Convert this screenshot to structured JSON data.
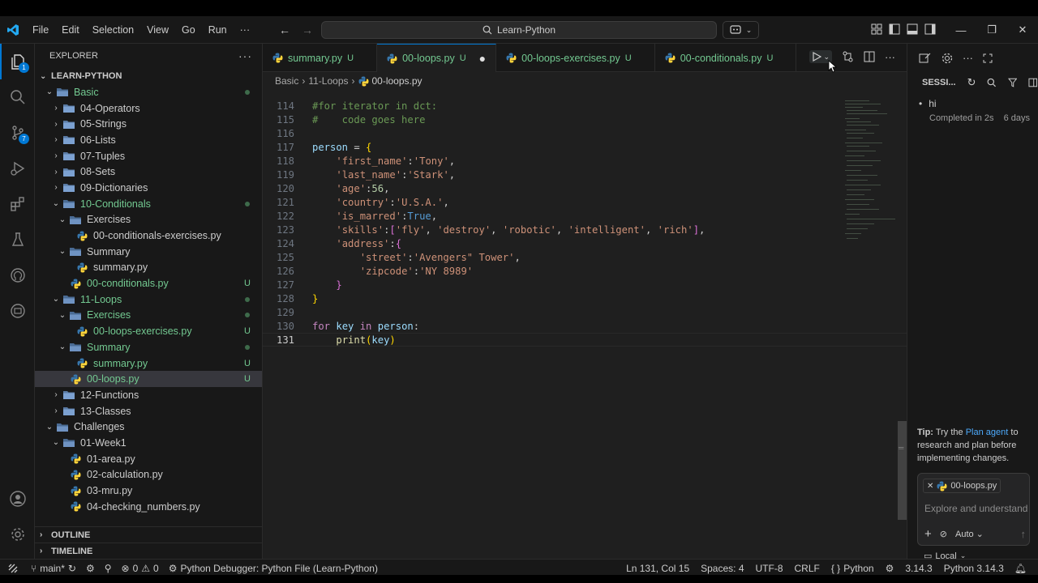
{
  "menu": [
    "File",
    "Edit",
    "Selection",
    "View",
    "Go",
    "Run",
    "···"
  ],
  "search": {
    "label": "Learn-Python"
  },
  "explorer": {
    "title": "EXPLORER",
    "root": "LEARN-PYTHON",
    "tree": [
      {
        "label": "Basic",
        "indent": 1,
        "type": "folder-open",
        "green": true,
        "dot": true
      },
      {
        "label": "04-Operators",
        "indent": 2,
        "type": "folder-closed"
      },
      {
        "label": "05-Strings",
        "indent": 2,
        "type": "folder-closed"
      },
      {
        "label": "06-Lists",
        "indent": 2,
        "type": "folder-closed"
      },
      {
        "label": "07-Tuples",
        "indent": 2,
        "type": "folder-closed"
      },
      {
        "label": "08-Sets",
        "indent": 2,
        "type": "folder-closed"
      },
      {
        "label": "09-Dictionaries",
        "indent": 2,
        "type": "folder-closed"
      },
      {
        "label": "10-Conditionals",
        "indent": 2,
        "type": "folder-open",
        "green": true,
        "dot": true
      },
      {
        "label": "Exercises",
        "indent": 3,
        "type": "folder-open"
      },
      {
        "label": "00-conditionals-exercises.py",
        "indent": 4,
        "type": "py"
      },
      {
        "label": "Summary",
        "indent": 3,
        "type": "folder-open"
      },
      {
        "label": "summary.py",
        "indent": 4,
        "type": "py"
      },
      {
        "label": "00-conditionals.py",
        "indent": 3,
        "type": "py",
        "green": true,
        "mark": "U"
      },
      {
        "label": "11-Loops",
        "indent": 2,
        "type": "folder-open",
        "green": true,
        "dot": true
      },
      {
        "label": "Exercises",
        "indent": 3,
        "type": "folder-open",
        "green": true,
        "dot": true
      },
      {
        "label": "00-loops-exercises.py",
        "indent": 4,
        "type": "py",
        "green": true,
        "mark": "U"
      },
      {
        "label": "Summary",
        "indent": 3,
        "type": "folder-open",
        "green": true,
        "dot": true
      },
      {
        "label": "summary.py",
        "indent": 4,
        "type": "py",
        "green": true,
        "mark": "U"
      },
      {
        "label": "00-loops.py",
        "indent": 3,
        "type": "py",
        "green": true,
        "mark": "U",
        "selected": true
      },
      {
        "label": "12-Functions",
        "indent": 2,
        "type": "folder-closed"
      },
      {
        "label": "13-Classes",
        "indent": 2,
        "type": "folder-closed"
      },
      {
        "label": "Challenges",
        "indent": 1,
        "type": "folder-open"
      },
      {
        "label": "01-Week1",
        "indent": 2,
        "type": "folder-open"
      },
      {
        "label": "01-area.py",
        "indent": 3,
        "type": "py"
      },
      {
        "label": "02-calculation.py",
        "indent": 3,
        "type": "py"
      },
      {
        "label": "03-mru.py",
        "indent": 3,
        "type": "py"
      },
      {
        "label": "04-checking_numbers.py",
        "indent": 3,
        "type": "py"
      }
    ],
    "outline": "OUTLINE",
    "timeline": "TIMELINE"
  },
  "tabs": [
    {
      "label": "summary.py",
      "mark": "U"
    },
    {
      "label": "00-loops.py",
      "mark": "U",
      "active": true,
      "dirty": true
    },
    {
      "label": "00-loops-exercises.py",
      "mark": "U"
    },
    {
      "label": "00-conditionals.py",
      "mark": "U"
    }
  ],
  "breadcrumb": [
    "Basic",
    "11-Loops",
    "00-loops.py"
  ],
  "code": [
    {
      "n": "114",
      "html": "<span class='c'>#for iterator in dct:</span>"
    },
    {
      "n": "115",
      "html": "<span class='c'>#    code goes here</span>"
    },
    {
      "n": "116",
      "html": ""
    },
    {
      "n": "117",
      "html": "<span class='v'>person</span> = <span class='y'>{</span>"
    },
    {
      "n": "118",
      "html": "    <span class='s'>'first_name'</span>:<span class='s'>'Tony'</span>,"
    },
    {
      "n": "119",
      "html": "    <span class='s'>'last_name'</span>:<span class='s'>'Stark'</span>,"
    },
    {
      "n": "120",
      "html": "    <span class='s'>'age'</span>:<span class='n'>56</span>,"
    },
    {
      "n": "121",
      "html": "    <span class='s'>'country'</span>:<span class='s'>'U.S.A.'</span>,"
    },
    {
      "n": "122",
      "html": "    <span class='s'>'is_marred'</span>:<span class='b'>True</span>,"
    },
    {
      "n": "123",
      "html": "    <span class='s'>'skills'</span>:<span class='p'>[</span><span class='s'>'fly'</span>, <span class='s'>'destroy'</span>, <span class='s'>'robotic'</span>, <span class='s'>'intelligent'</span>, <span class='s'>'rich'</span><span class='p'>]</span>,"
    },
    {
      "n": "124",
      "html": "    <span class='s'>'address'</span>:<span class='p'>{</span>"
    },
    {
      "n": "125",
      "html": "        <span class='s'>'street'</span>:<span class='s'>'Avengers\" Tower'</span>,"
    },
    {
      "n": "126",
      "html": "        <span class='s'>'zipcode'</span>:<span class='s'>'NY 8989'</span>"
    },
    {
      "n": "127",
      "html": "    <span class='p'>}</span>"
    },
    {
      "n": "128",
      "html": "<span class='y'>}</span>"
    },
    {
      "n": "129",
      "html": ""
    },
    {
      "n": "130",
      "html": "<span class='k'>for</span> <span class='v'>key</span> <span class='k'>in</span> <span class='v'>person</span>:"
    },
    {
      "n": "131",
      "html": "    <span class='f'>print</span><span class='y'>(</span><span class='v'>key</span><span class='y'>)</span>",
      "cur": true
    }
  ],
  "chat": {
    "sessions_title": "SESSI...",
    "session_name": "hi",
    "session_status": "Completed in 2s",
    "session_time": "6 days",
    "tip_prefix": "Tip:",
    "tip_a": " Try the ",
    "tip_link": "Plan agent",
    "tip_b": " to research and plan before implementing changes.",
    "file_chip": "00-loops.py",
    "input_placeholder": "Explore and understand y",
    "mode": "Auto",
    "location": "Local"
  },
  "status": {
    "branch": "main*",
    "errors": "0",
    "warnings": "0",
    "debugger": "Python Debugger: Python File (Learn-Python)",
    "position": "Ln 131, Col 15",
    "spaces": "Spaces: 4",
    "encoding": "UTF-8",
    "eol": "CRLF",
    "language": "Python",
    "env_version": "3.14.3",
    "interpreter": "Python 3.14.3"
  },
  "colors": {
    "accent": "#0078d4",
    "untracked": "#73c991",
    "string": "#ce9178"
  }
}
